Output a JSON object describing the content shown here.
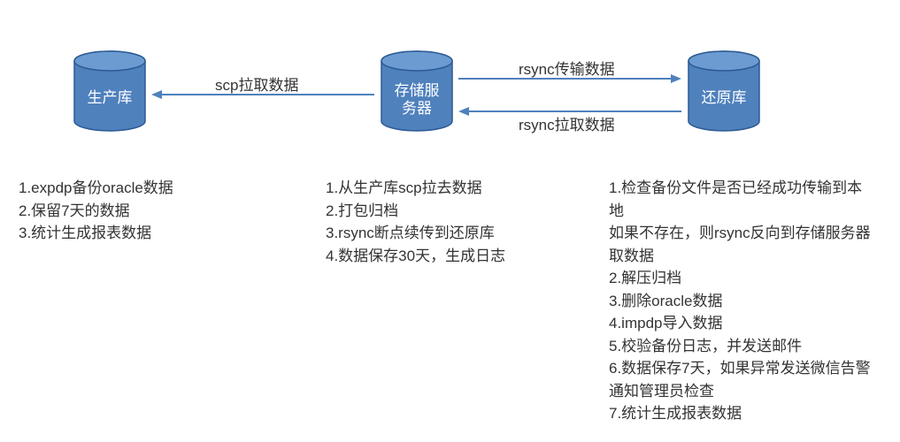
{
  "colors": {
    "blue": "#4f81bd"
  },
  "nodes": {
    "prod": {
      "label": "生产库"
    },
    "storage": {
      "label_line1": "存储服",
      "label_line2": "务器"
    },
    "restore": {
      "label": "还原库"
    }
  },
  "arrows": {
    "scp_pull": {
      "label": "scp拉取数据"
    },
    "rsync_push": {
      "label": "rsync传输数据"
    },
    "rsync_pull": {
      "label": "rsync拉取数据"
    }
  },
  "lists": {
    "prod": [
      "1.expdp备份oracle数据",
      "2.保留7天的数据",
      "3.统计生成报表数据"
    ],
    "storage": [
      "1.从生产库scp拉去数据",
      "2.打包归档",
      "3.rsync断点续传到还原库",
      "4.数据保存30天，生成日志"
    ],
    "restore": [
      "1.检查备份文件是否已经成功传输到本地",
      "如果不存在，则rsync反向到存储服务器取数据",
      "2.解压归档",
      "3.删除oracle数据",
      "4.impdp导入数据",
      "5.校验备份日志，并发送邮件",
      "6.数据保存7天，如果异常发送微信告警通知管理员检查",
      "7.统计生成报表数据"
    ]
  }
}
